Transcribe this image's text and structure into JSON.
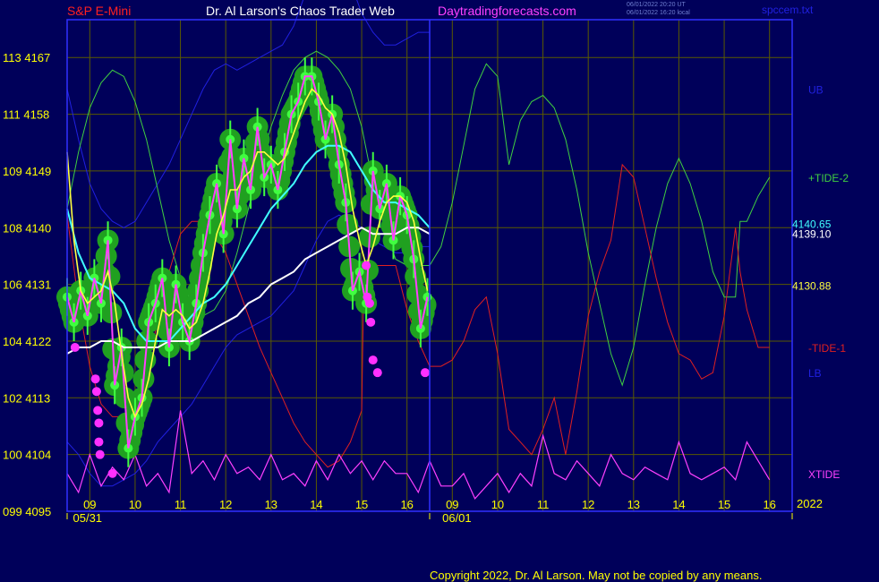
{
  "header": {
    "symbol": "S&P E-Mini",
    "site": "Dr. Al Larson's Chaos Trader Web",
    "url": "Daytradingforecasts.com",
    "timestamp_ut": "06/01/2022 20:20 UT",
    "timestamp_local": "06/01/2022 16:20 local",
    "file": "spccem.txt"
  },
  "copyright": "Copyright 2022, Dr. Al Larson. May not be copied by any means.",
  "colors": {
    "background": "#00005a",
    "frame": "#3030ff",
    "grid": "#5a5a00",
    "symbol": "#ff2020",
    "site": "#ffffff",
    "url": "#ff40ff",
    "tide2": "#40d040",
    "tide1": "#e02020",
    "bands": "#2020e0",
    "xtide": "#ff40ff",
    "price": "#ff40ff",
    "fast_ma": "#ffff40",
    "mid_ma": "#40ffff",
    "slow_ma": "#ffffff",
    "glow": "#20a020",
    "glow_light": "#40ff40",
    "signal": "#ff30ff",
    "labels": "#ffff00"
  },
  "chart_data": {
    "type": "line",
    "xlim": [
      0,
      32
    ],
    "ylim": [
      4095,
      4173
    ],
    "y_ticks": [
      {
        "value": 4095,
        "label": "099 4095"
      },
      {
        "value": 4104,
        "label": "100 4104"
      },
      {
        "value": 4113,
        "label": "102 4113"
      },
      {
        "value": 4122,
        "label": "104 4122"
      },
      {
        "value": 4131,
        "label": "106 4131"
      },
      {
        "value": 4140,
        "label": "108 4140"
      },
      {
        "value": 4149,
        "label": "109 4149"
      },
      {
        "value": 4158,
        "label": "111 4158"
      },
      {
        "value": 4167,
        "label": "113 4167"
      }
    ],
    "x_ticks": [
      {
        "x": 1,
        "label": "09"
      },
      {
        "x": 3,
        "label": "10"
      },
      {
        "x": 5,
        "label": "11"
      },
      {
        "x": 7,
        "label": "12"
      },
      {
        "x": 9,
        "label": "13"
      },
      {
        "x": 11,
        "label": "14"
      },
      {
        "x": 13,
        "label": "15"
      },
      {
        "x": 15,
        "label": "16"
      },
      {
        "x": 17,
        "label": "09"
      },
      {
        "x": 19,
        "label": "10"
      },
      {
        "x": 21,
        "label": "11"
      },
      {
        "x": 23,
        "label": "12"
      },
      {
        "x": 25,
        "label": "13"
      },
      {
        "x": 27,
        "label": "14"
      },
      {
        "x": 29,
        "label": "15"
      },
      {
        "x": 31,
        "label": "16"
      }
    ],
    "x_ticks_extra": [
      0,
      32
    ],
    "date_labels": [
      {
        "x": 0.9,
        "label": "05/31"
      },
      {
        "x": 17.2,
        "label": "06/01"
      }
    ],
    "year_label": "2022",
    "now_x": 16,
    "price_labels": [
      {
        "value": 4140.65,
        "label": "4140.65"
      },
      {
        "value": 4139.1,
        "label": "4139.10"
      },
      {
        "value": 4130.88,
        "label": "4130.88"
      }
    ],
    "series_labels": [
      {
        "label": "UB",
        "y": 4162
      },
      {
        "label": "+TIDE-2",
        "y": 4148
      },
      {
        "label": "-TIDE-1",
        "y": 4121
      },
      {
        "label": "LB",
        "y": 4117
      },
      {
        "label": "XTIDE",
        "y": 4101
      }
    ],
    "series": [
      {
        "name": "UB",
        "x": [
          0,
          0.5,
          1,
          1.5,
          2,
          2.5,
          3,
          3.5,
          4,
          4.5,
          5,
          5.5,
          6,
          6.5,
          7,
          7.5,
          8,
          8.5,
          9,
          9.5,
          10,
          10.5,
          11,
          11.5,
          12,
          12.5,
          13,
          13.5,
          14,
          14.5,
          15,
          15.5,
          16
        ],
        "y": [
          4162,
          4154,
          4147,
          4143,
          4141,
          4140,
          4141,
          4144,
          4147,
          4150,
          4154,
          4158,
          4162,
          4165,
          4166,
          4165,
          4166,
          4167,
          4168,
          4169,
          4172,
          4177,
          4182,
          4184,
          4183,
          4179,
          4174,
          4171,
          4169,
          4169,
          4170,
          4171,
          4171
        ]
      },
      {
        "name": "LB",
        "x": [
          0,
          0.5,
          1,
          1.5,
          2,
          2.5,
          3,
          3.5,
          4,
          4.5,
          5,
          5.5,
          6,
          6.5,
          7,
          7.5,
          8,
          8.5,
          9,
          9.5,
          10,
          10.5,
          11,
          11.5,
          12,
          12.5,
          13,
          13.5,
          14,
          14.5,
          15,
          15.5,
          16
        ],
        "y": [
          4106,
          4104,
          4101,
          4099,
          4099,
          4100,
          4101,
          4103,
          4106,
          4108,
          4110,
          4112,
          4115,
          4118,
          4121,
          4123,
          4124,
          4125,
          4126,
          4128,
          4130,
          4134,
          4138,
          4141,
          4142,
          4141,
          4140,
          4138,
          4137,
          4136,
          4136,
          4137,
          4137
        ]
      },
      {
        "name": "+TIDE-2",
        "x": [
          0,
          0.5,
          1,
          1.5,
          2,
          2.5,
          3,
          3.5,
          4,
          4.5,
          5,
          5.5,
          6,
          6.5,
          7,
          7.5,
          8,
          8.5,
          9,
          9.5,
          10,
          10.5,
          11,
          11.5,
          12,
          12.5,
          13,
          13.5,
          14,
          14.5,
          15,
          15.5,
          16,
          16.5,
          17,
          17.5,
          18,
          18.5,
          19,
          19.5,
          20,
          20.5,
          21,
          21.5,
          22,
          22.5,
          23,
          23.5,
          24,
          24.5,
          25,
          25.5,
          26,
          26.5,
          27,
          27.5,
          28,
          28.5,
          29,
          29.5,
          29.7,
          30,
          30.5,
          31
        ],
        "y": [
          4143,
          4152,
          4159,
          4163,
          4165,
          4164,
          4160,
          4154,
          4146,
          4138,
          4132,
          4128,
          4126,
          4127,
          4130,
          4136,
          4143,
          4150,
          4156,
          4161,
          4165,
          4167,
          4168,
          4167,
          4165,
          4162,
          4156,
          4147,
          4140,
          4135,
          4134,
          4134,
          4134,
          4137,
          4144,
          4153,
          4162,
          4166,
          4164,
          4150,
          4157,
          4160,
          4161,
          4159,
          4154,
          4146,
          4136,
          4128,
          4120,
          4115,
          4121,
          4131,
          4140,
          4147,
          4151,
          4147,
          4141,
          4133,
          4129,
          4129,
          4141,
          4141,
          4145,
          4148
        ]
      },
      {
        "name": "-TIDE-1",
        "x": [
          0,
          0.5,
          1,
          1.5,
          2,
          2.5,
          3,
          3.5,
          4,
          4.5,
          5,
          5.5,
          6,
          6.5,
          7,
          7.5,
          8,
          8.5,
          9,
          9.5,
          10,
          10.5,
          11,
          11.5,
          12,
          12.5,
          13,
          13.1,
          13.5,
          14,
          14.5,
          15,
          15.5,
          16,
          16.5,
          17,
          17.5,
          18,
          18.5,
          19,
          19.5,
          20,
          20.5,
          21,
          21.5,
          22,
          22.5,
          23,
          23.5,
          24,
          24.5,
          25,
          25.5,
          26,
          26.5,
          27,
          27.5,
          28,
          28.5,
          29,
          29.5,
          29.7,
          30,
          30.5,
          31
        ],
        "y": [
          4142,
          4128,
          4118,
          4112,
          4110,
          4110,
          4113,
          4118,
          4125,
          4133,
          4139,
          4141,
          4141,
          4139,
          4136,
          4131,
          4126,
          4121,
          4117,
          4113,
          4109,
          4106,
          4104,
          4102,
          4103,
          4106,
          4111,
          4134,
          4134,
          4134,
          4134,
          4127,
          4122,
          4118,
          4118,
          4119,
          4122,
          4127,
          4129,
          4120,
          4108,
          4106,
          4104,
          4108,
          4113,
          4104,
          4114,
          4126,
          4133,
          4138,
          4150,
          4148,
          4140,
          4132,
          4125,
          4120,
          4119,
          4116,
          4117,
          4126,
          4140,
          4133,
          4127,
          4121,
          4121
        ]
      },
      {
        "name": "XTIDE",
        "x": [
          0,
          0.5,
          1,
          1.5,
          2,
          2.5,
          3,
          3.5,
          4,
          4.5,
          5,
          5.5,
          6,
          6.5,
          7,
          7.5,
          8,
          8.5,
          9,
          9.5,
          10,
          10.5,
          11,
          11.5,
          12,
          12.5,
          13,
          13.5,
          14,
          14.5,
          15,
          15.5,
          16,
          16.5,
          17,
          17.5,
          18,
          18.5,
          19,
          19.5,
          20,
          20.5,
          21,
          21.5,
          22,
          22.5,
          23,
          23.5,
          24,
          24.5,
          25,
          25.5,
          26,
          26.5,
          27,
          27.5,
          28,
          28.5,
          29,
          29.5,
          30,
          30.5,
          31
        ],
        "y": [
          4101,
          4098,
          4104,
          4099,
          4102,
          4100,
          4104,
          4099,
          4101,
          4098,
          4111,
          4101,
          4103,
          4100,
          4104,
          4101,
          4102,
          4100,
          4104,
          4100,
          4101,
          4099,
          4103,
          4100,
          4104,
          4101,
          4103,
          4100,
          4103,
          4101,
          4101,
          4098,
          4103,
          4099,
          4099,
          4101,
          4097,
          4099,
          4101,
          4098,
          4101,
          4099,
          4107,
          4101,
          4100,
          4103,
          4101,
          4099,
          4104,
          4101,
          4100,
          4102,
          4101,
          4100,
          4106,
          4101,
          4100,
          4101,
          4102,
          4100,
          4106,
          4103,
          4100
        ]
      },
      {
        "name": "Price",
        "x": [
          0,
          0.3,
          0.6,
          0.9,
          1.2,
          1.5,
          1.8,
          2.1,
          2.4,
          2.7,
          3,
          3.3,
          3.6,
          3.9,
          4.2,
          4.5,
          4.8,
          5.1,
          5.4,
          5.7,
          6,
          6.3,
          6.6,
          6.9,
          7.2,
          7.5,
          7.8,
          8.1,
          8.4,
          8.7,
          9,
          9.3,
          9.6,
          9.9,
          10.2,
          10.5,
          10.8,
          11.1,
          11.4,
          11.7,
          12,
          12.3,
          12.6,
          12.9,
          13.2,
          13.5,
          13.8,
          14.1,
          14.4,
          14.7,
          15,
          15.3,
          15.6,
          15.9
        ],
        "y": [
          4129,
          4125,
          4130,
          4126,
          4132,
          4128,
          4138,
          4115,
          4121,
          4105,
          4110,
          4113,
          4125,
          4128,
          4132,
          4121,
          4131,
          4125,
          4122,
          4128,
          4136,
          4142,
          4147,
          4139,
          4154,
          4143,
          4151,
          4146,
          4156,
          4148,
          4150,
          4146,
          4152,
          4158,
          4160,
          4164,
          4164,
          4160,
          4154,
          4158,
          4150,
          4144,
          4130,
          4133,
          4128,
          4149,
          4143,
          4147,
          4138,
          4145,
          4142,
          4135,
          4124,
          4129
        ]
      },
      {
        "name": "Fast MA",
        "x": [
          0,
          0.3,
          0.6,
          0.9,
          1.2,
          1.5,
          1.8,
          2.1,
          2.4,
          2.7,
          3,
          3.3,
          3.6,
          3.9,
          4.2,
          4.5,
          4.8,
          5.1,
          5.4,
          5.7,
          6,
          6.3,
          6.6,
          6.9,
          7.2,
          7.5,
          7.8,
          8.1,
          8.4,
          8.7,
          9,
          9.3,
          9.6,
          9.9,
          10.2,
          10.5,
          10.8,
          11.1,
          11.4,
          11.7,
          12,
          12.3,
          12.6,
          12.9,
          13.2,
          13.5,
          13.8,
          14.1,
          14.4,
          14.7,
          15,
          15.3,
          15.6,
          15.9
        ],
        "y": [
          4152,
          4138,
          4130,
          4128,
          4129,
          4130,
          4133,
          4128,
          4120,
          4113,
          4110,
          4112,
          4116,
          4122,
          4127,
          4126,
          4127,
          4126,
          4124,
          4125,
          4128,
          4133,
          4139,
          4142,
          4146,
          4146,
          4148,
          4149,
          4152,
          4152,
          4151,
          4150,
          4151,
          4154,
          4157,
          4160,
          4162,
          4161,
          4159,
          4158,
          4155,
          4150,
          4143,
          4138,
          4134,
          4137,
          4141,
          4144,
          4145,
          4145,
          4144,
          4141,
          4135,
          4130
        ]
      },
      {
        "name": "Mid MA",
        "x": [
          0,
          0.5,
          1,
          1.5,
          2,
          2.5,
          3,
          3.5,
          4,
          4.5,
          5,
          5.5,
          6,
          6.5,
          7,
          7.5,
          8,
          8.5,
          9,
          9.5,
          10,
          10.5,
          11,
          11.5,
          12,
          12.5,
          13,
          13.5,
          14,
          14.5,
          15,
          15.5,
          16
        ],
        "y": [
          4143,
          4136,
          4132,
          4131,
          4130,
          4128,
          4124,
          4122,
          4122,
          4122,
          4124,
          4126,
          4128,
          4129,
          4131,
          4134,
          4137,
          4140,
          4143,
          4145,
          4147,
          4150,
          4152,
          4153,
          4153,
          4152,
          4149,
          4146,
          4144,
          4144,
          4143,
          4142,
          4140
        ]
      },
      {
        "name": "Slow MA",
        "x": [
          0,
          0.5,
          1,
          1.5,
          2,
          2.5,
          3,
          3.5,
          4,
          4.5,
          5,
          5.5,
          6,
          6.5,
          7,
          7.5,
          8,
          8.5,
          9,
          9.5,
          10,
          10.5,
          11,
          11.5,
          12,
          12.5,
          13,
          13.5,
          14,
          14.5,
          15,
          15.5,
          16
        ],
        "y": [
          4120,
          4121,
          4121,
          4122,
          4122,
          4121,
          4121,
          4121,
          4121,
          4122,
          4122,
          4122,
          4123,
          4124,
          4125,
          4126,
          4128,
          4129,
          4131,
          4132,
          4133,
          4135,
          4136,
          4137,
          4138,
          4139,
          4140,
          4139,
          4139,
          4139,
          4140,
          4140,
          4139
        ]
      }
    ],
    "signal_points": [
      {
        "x": 0.35,
        "y": 4121
      },
      {
        "x": 1.25,
        "y": 4116
      },
      {
        "x": 1.3,
        "y": 4114
      },
      {
        "x": 1.35,
        "y": 4111
      },
      {
        "x": 1.4,
        "y": 4109
      },
      {
        "x": 1.4,
        "y": 4106
      },
      {
        "x": 1.45,
        "y": 4104
      },
      {
        "x": 2.0,
        "y": 4101
      },
      {
        "x": 13.2,
        "y": 4134
      },
      {
        "x": 13.25,
        "y": 4129
      },
      {
        "x": 13.35,
        "y": 4128
      },
      {
        "x": 13.4,
        "y": 4125
      },
      {
        "x": 13.5,
        "y": 4119
      },
      {
        "x": 13.7,
        "y": 4117
      },
      {
        "x": 15.8,
        "y": 4117
      }
    ]
  }
}
